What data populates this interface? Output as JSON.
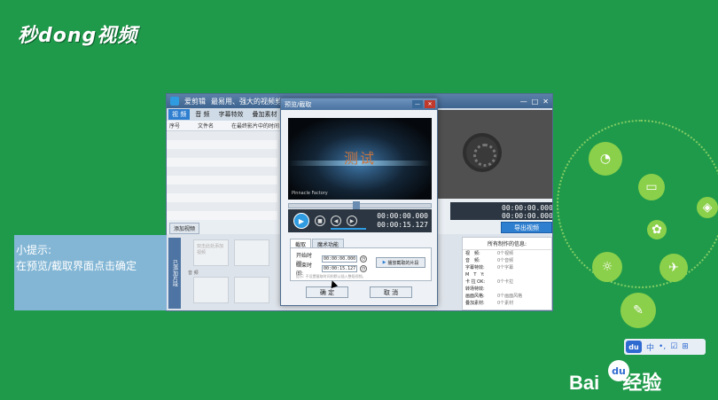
{
  "watermark_top": "秒dong视频",
  "editor": {
    "title": "爱剪辑",
    "subtitle": "最易用、强大的视频剪辑软件",
    "tabs": [
      "视 频",
      "音 频",
      "字幕特效",
      "叠加素材",
      "转"
    ],
    "columns": [
      "序号",
      "文件名",
      "在最终影片中的时间"
    ],
    "add_video": "添加视频",
    "track_side_label": "已添加片段",
    "thumb_placeholder": "双击此处添加视频",
    "track_label": "音 频",
    "right_time_top": "00:00:00.000",
    "right_time_bottom": "00:00:00.000",
    "export_label": "导出视频",
    "info": {
      "header": "所有制作的信息:",
      "rows": [
        {
          "k": "视　频:",
          "v": "0个视频"
        },
        {
          "k": "音　频:",
          "v": "0个音频"
        },
        {
          "k": "字幕特效:",
          "v": "0个字幕"
        },
        {
          "k": "M　T　Y:",
          "v": ""
        },
        {
          "k": "卡 拉 OK:",
          "v": "0个卡拉"
        },
        {
          "k": "转场特效:",
          "v": ""
        },
        {
          "k": "画面风格:",
          "v": "0个画面风格"
        },
        {
          "k": "叠加素材:",
          "v": "0个素材"
        }
      ]
    }
  },
  "dialog": {
    "title": "预览/截取",
    "video_text": "测试",
    "video_brand": "Pinnacle Factory",
    "time_current": "00:00:00.000",
    "time_total": "00:00:15.127",
    "tabs": [
      "截取",
      "魔术功能"
    ],
    "start_label": "开始时间:",
    "start_value": "00:00:00.000",
    "end_label": "结束时间:",
    "end_value": "00:00:15.127",
    "cut_button": "播放截取的片段",
    "hint": "提示: 不设置截取时间则默认插入整段视频。",
    "ok": "确 定",
    "cancel": "取 消"
  },
  "tip": {
    "line1": "小提示:",
    "line2": "在预览/截取界面点击确定"
  },
  "baidu": {
    "du_logo": "du",
    "bar_items": [
      "中",
      "•,",
      "☑",
      "⊞"
    ],
    "brand_text": "Bai",
    "brand_du": "du",
    "brand_suffix": "经验"
  },
  "colors": {
    "background": "#1f9a4a",
    "accent": "#2f7fd0",
    "tip_bg": "#8cb9e1"
  }
}
